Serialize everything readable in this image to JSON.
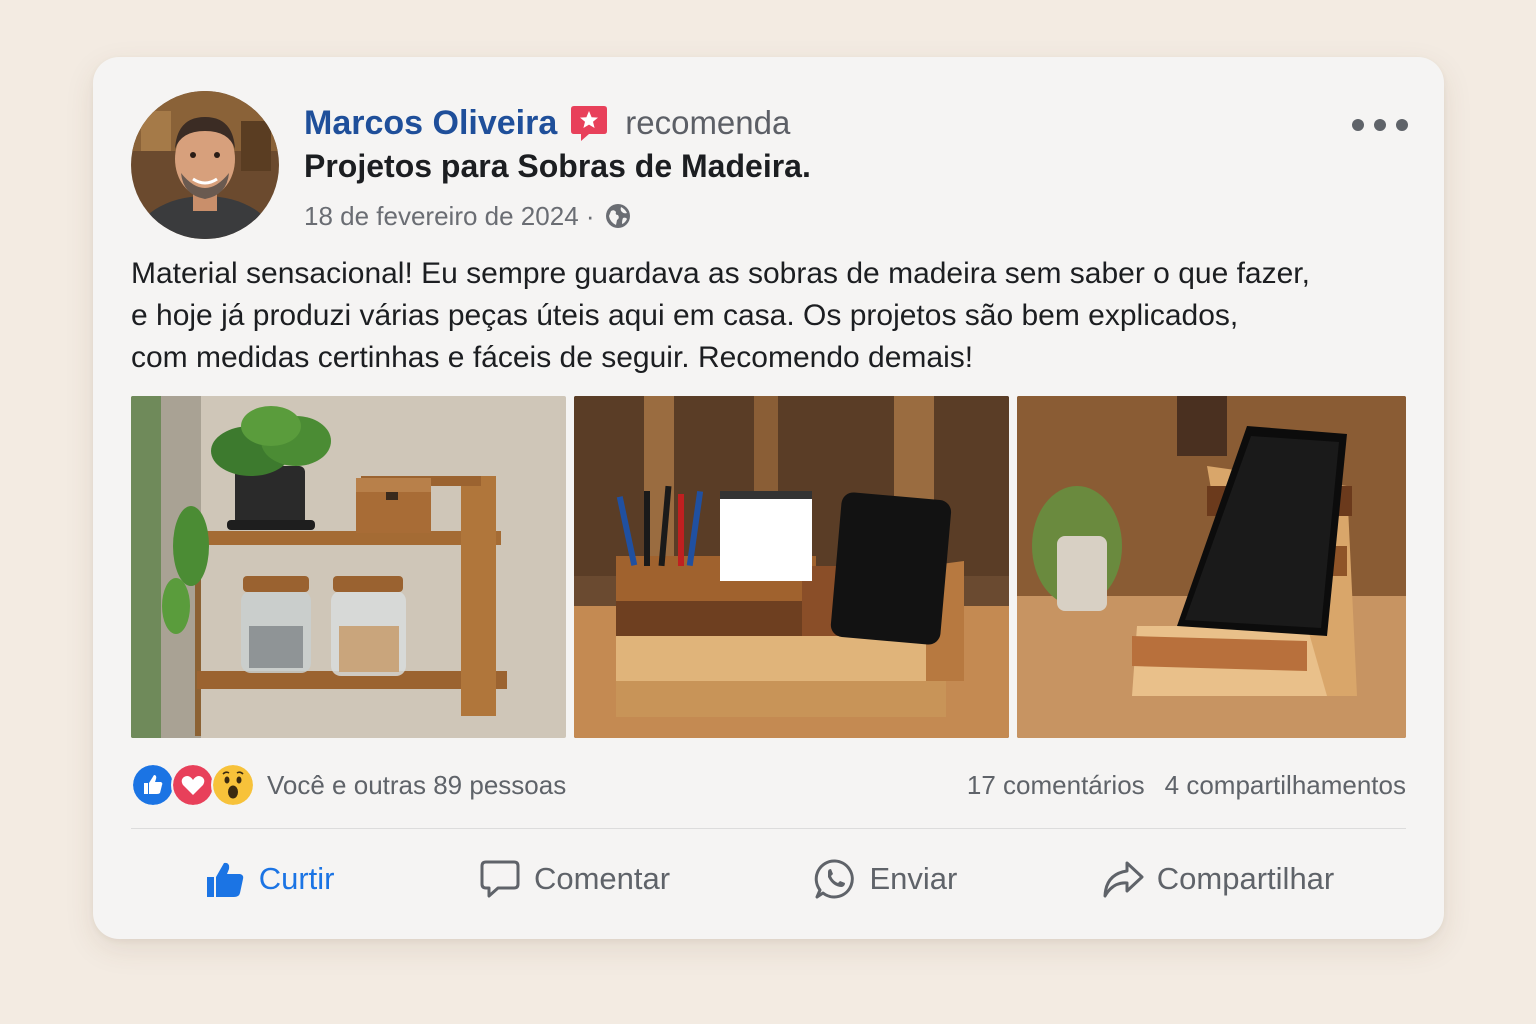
{
  "post": {
    "author": "Marcos Oliveira",
    "action": "recomenda",
    "page": "Projetos para Sobras de Madeira.",
    "date": "18 de fevereiro de 2024 ·",
    "body": [
      "Material sensacional! Eu sempre guardava as sobras de madeira sem saber o que fazer,",
      "e hoje já produzi várias peças úteis aqui em casa. Os projetos são bem explicados,",
      "com medidas certinhas e fáceis de seguir. Recomendo demais!"
    ],
    "photos": [
      {
        "icon": "wall-shelf-photo"
      },
      {
        "icon": "desk-organizer-photo"
      },
      {
        "icon": "phone-stand-photo"
      }
    ]
  },
  "reactions": {
    "icons": [
      "like-icon",
      "love-icon",
      "wow-icon"
    ],
    "count_text": "Você e outras 89 pessoas",
    "comments": "17 comentários",
    "shares": "4 compartilhamentos"
  },
  "actions": {
    "like": "Curtir",
    "comment": "Comentar",
    "send": "Enviar",
    "share": "Compartilhar"
  },
  "colors": {
    "accent": "#1b74e4",
    "author": "#1f4f9a",
    "badge": "#e8405a",
    "background": "#f3ebe2",
    "card": "#f5f4f3"
  }
}
